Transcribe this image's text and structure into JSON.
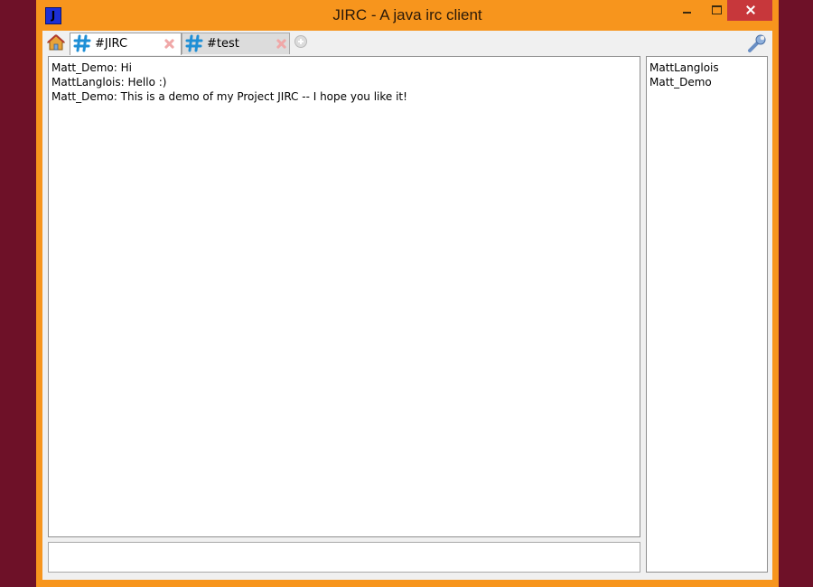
{
  "window": {
    "title": "JIRC - A java irc client",
    "app_icon_letter": "J",
    "accent": "#f7951d",
    "close_color": "#c7373b"
  },
  "tabs": [
    {
      "label": "#JIRC",
      "icon": "hash-icon",
      "active": true
    },
    {
      "label": "#test",
      "icon": "hash-icon",
      "active": false
    }
  ],
  "toolbar": {
    "home_icon": "home-icon",
    "add_icon": "add-tab-icon",
    "settings_icon": "wrench-icon"
  },
  "chat": {
    "messages": [
      "Matt_Demo: Hi",
      "MattLanglois: Hello :)",
      "Matt_Demo: This is a demo of my Project JIRC -- I hope you like it!"
    ]
  },
  "input": {
    "value": ""
  },
  "users": [
    "MattLanglois",
    "Matt_Demo"
  ]
}
